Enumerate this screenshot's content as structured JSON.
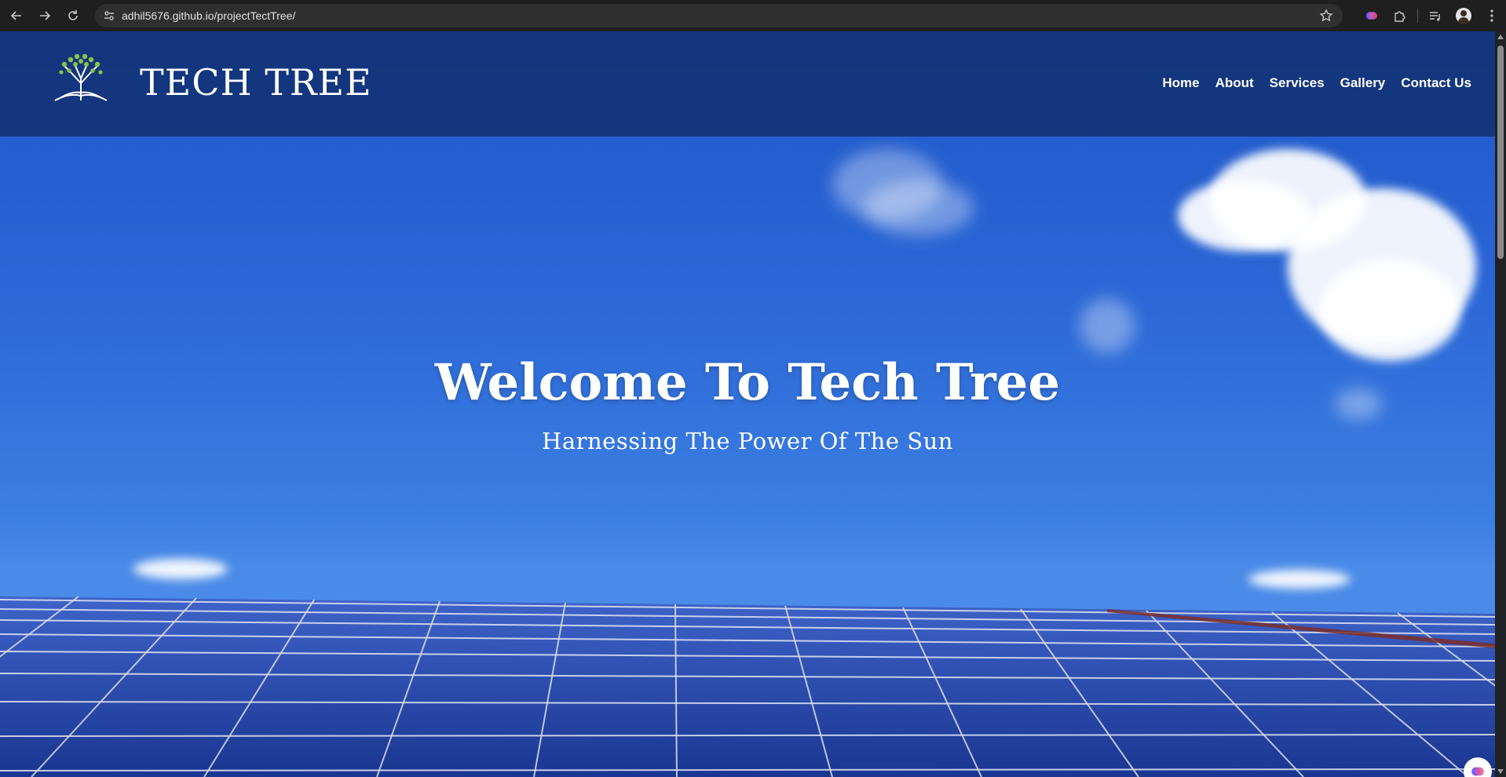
{
  "browser": {
    "url": "adhil5676.github.io/projectTectTree/"
  },
  "site": {
    "brand": "TECH TREE",
    "nav": [
      "Home",
      "About",
      "Services",
      "Gallery",
      "Contact Us"
    ],
    "hero_title": "Welcome To Tech Tree",
    "hero_subtitle": "Harnessing The Power Of The Sun"
  },
  "colors": {
    "header_overlay": "#0e2860",
    "sky_top": "#1f56c8",
    "sky_bottom": "#4a8be8",
    "panel_blue": "#1e3f9c",
    "leaf_green": "#8bc34a"
  }
}
